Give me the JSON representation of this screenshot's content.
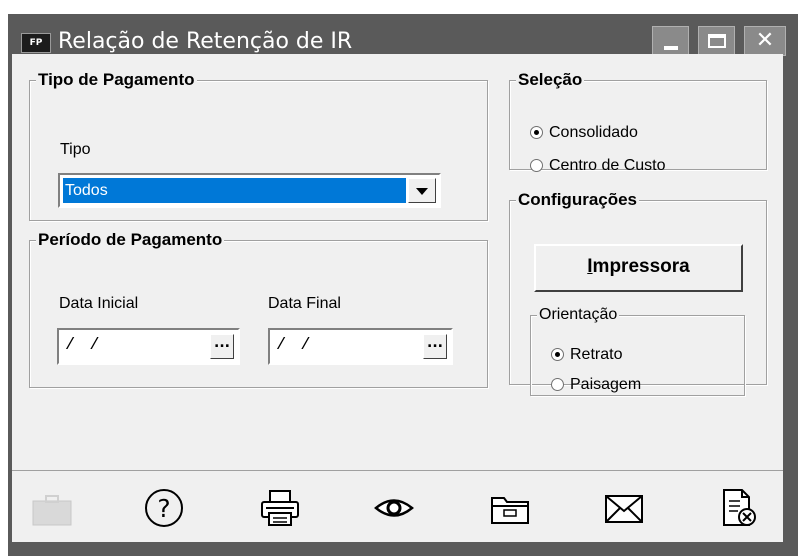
{
  "window": {
    "app_icon_text": "FP",
    "title": "Relação de Retenção de IR"
  },
  "tipo_pagamento": {
    "legend": "Tipo de Pagamento",
    "tipo_label": "Tipo",
    "tipo_value": "Todos"
  },
  "periodo": {
    "legend": "Período de Pagamento",
    "data_inicial_label": "Data Inicial",
    "data_inicial_value": "/ /",
    "data_final_label": "Data Final",
    "data_final_value": "/ /",
    "ellipsis": "..."
  },
  "selecao": {
    "legend": "Seleção",
    "options": [
      {
        "label": "Consolidado",
        "selected": true
      },
      {
        "label": "Centro de Custo",
        "selected": false
      }
    ]
  },
  "configuracoes": {
    "legend": "Configurações",
    "impressora_first": "I",
    "impressora_rest": "mpressora",
    "orientacao_legend": "Orientação",
    "options": [
      {
        "label": "Retrato",
        "selected": true
      },
      {
        "label": "Paisagem",
        "selected": false
      }
    ]
  },
  "toolbar": {
    "icons": [
      "briefcase-icon",
      "help-icon",
      "printer-icon",
      "preview-eye-icon",
      "folder-icon",
      "mail-icon",
      "close-document-icon"
    ],
    "help_glyph": "?"
  },
  "colors": {
    "title_bar": "#5a5a5a",
    "selection": "#0078d7",
    "face": "#f0f0f0"
  }
}
